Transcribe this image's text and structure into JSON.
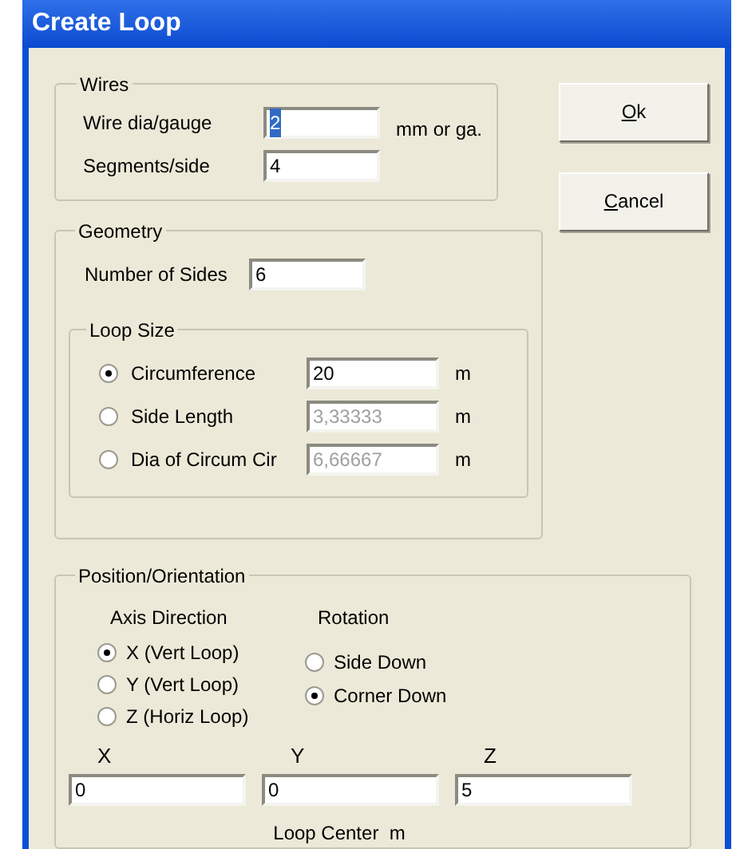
{
  "window": {
    "title": "Create Loop"
  },
  "wires": {
    "title": "Wires",
    "fields": [
      {
        "label": "Wire dia/gauge",
        "value": "2",
        "unit": "mm or ga.",
        "text_selected": true
      },
      {
        "label": "Segments/side",
        "value": "4",
        "text_selected": false
      }
    ]
  },
  "buttons": [
    {
      "key": "O",
      "rest": "k"
    },
    {
      "key": "C",
      "rest": "ancel"
    }
  ],
  "geometry": {
    "title": "Geometry",
    "number_of_sides": {
      "label": "Number of Sides",
      "value": "6"
    },
    "loop_size": {
      "title": "Loop Size",
      "options": [
        {
          "label": "Circumference",
          "value": "20",
          "unit": "m",
          "selected": true,
          "disabled": false
        },
        {
          "label": "Side Length",
          "value": "3,33333",
          "unit": "m",
          "selected": false,
          "disabled": true
        },
        {
          "label": "Dia of Circum Cir",
          "value": "6,66667",
          "unit": "m",
          "selected": false,
          "disabled": true
        }
      ]
    }
  },
  "position": {
    "title": "Position/Orientation",
    "axis_direction": {
      "title": "Axis Direction",
      "options": [
        {
          "label": "X (Vert Loop)",
          "selected": true
        },
        {
          "label": "Y (Vert Loop)",
          "selected": false
        },
        {
          "label": "Z (Horiz Loop)",
          "selected": false
        }
      ]
    },
    "rotation": {
      "title": "Rotation",
      "options": [
        {
          "label": "Side Down",
          "selected": false
        },
        {
          "label": "Corner Down",
          "selected": true
        }
      ]
    },
    "center": {
      "fields": [
        {
          "label": "X",
          "value": "0"
        },
        {
          "label": "Y",
          "value": "0"
        },
        {
          "label": "Z",
          "value": "5"
        }
      ],
      "caption": "Loop Center  m"
    }
  }
}
